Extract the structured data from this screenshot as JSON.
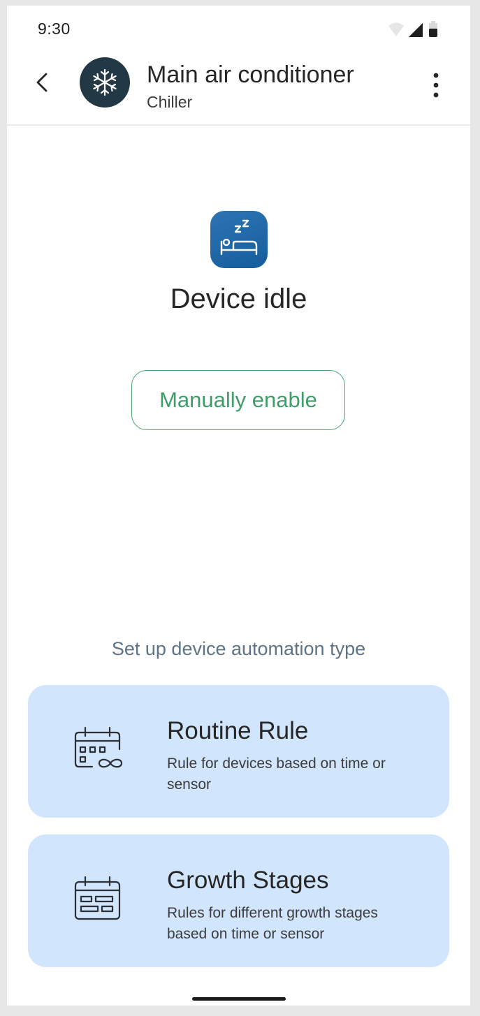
{
  "status_bar": {
    "time": "9:30",
    "icons": [
      "wifi-icon",
      "signal-icon",
      "battery-icon"
    ]
  },
  "app_bar": {
    "title": "Main air conditioner",
    "subtitle": "Chiller",
    "back_icon": "chevron-left-icon",
    "avatar_icon": "snowflake-icon",
    "menu_icon": "more-vertical-icon"
  },
  "idle": {
    "icon": "sleeping-bed-icon",
    "title": "Device idle",
    "button_label": "Manually enable"
  },
  "automation": {
    "section_label": "Set up device automation type",
    "options": [
      {
        "icon": "calendar-infinity-icon",
        "title": "Routine Rule",
        "description": "Rule for devices based on time or sensor"
      },
      {
        "icon": "calendar-stages-icon",
        "title": "Growth Stages",
        "description": "Rules for different growth stages based on time or sensor"
      }
    ]
  },
  "colors": {
    "avatar_bg": "#223844",
    "idle_icon_bg": "#1f68a7",
    "accent_green": "#3f9d69",
    "card_bg": "#d1e5fc",
    "section_label": "#5e7486"
  }
}
